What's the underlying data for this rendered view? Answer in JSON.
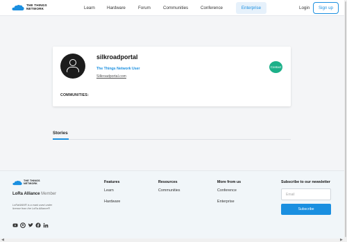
{
  "header": {
    "logo_text": "THE THINGS\nNETWORK",
    "nav": [
      {
        "label": "Learn"
      },
      {
        "label": "Hardware"
      },
      {
        "label": "Forum"
      },
      {
        "label": "Communities"
      },
      {
        "label": "Conference"
      }
    ],
    "enterprise_label": "Enterprise",
    "login_label": "Login",
    "signup_label": "Sign up"
  },
  "profile": {
    "username": "silkroadportal",
    "role": "The Things Network User",
    "link": "Silkroadportal.com",
    "contact_label": "Contact",
    "communities_label": "COMMUNITIES:"
  },
  "stories": {
    "tab_label": "Stories"
  },
  "footer": {
    "logo_text": "THE THINGS\nNETWORK",
    "lora_name": "LoRa Alliance",
    "lora_member": "Member",
    "lora_note": "LoRaWAN® is a mark used under license from the LoRa Alliance®",
    "social_icons": [
      "youtube-icon",
      "github-icon",
      "twitter-icon",
      "facebook-icon",
      "linkedin-icon"
    ],
    "columns": [
      {
        "heading": "Features",
        "links": [
          "Learn",
          "Hardware"
        ]
      },
      {
        "heading": "Resources",
        "links": [
          "Communities"
        ]
      },
      {
        "heading": "More from us",
        "links": [
          "Conference",
          "Enterprise"
        ]
      }
    ],
    "subscribe_heading": "Subscribe to our newsletter",
    "email_placeholder": "Email",
    "subscribe_label": "Subscribe"
  },
  "colors": {
    "accent": "#1a8fe0",
    "contact": "#1cb089"
  }
}
